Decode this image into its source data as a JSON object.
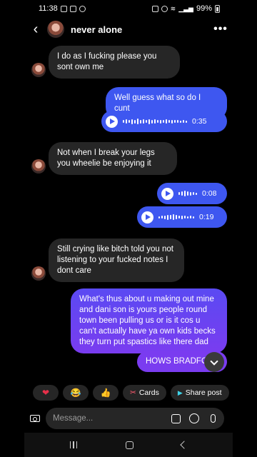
{
  "status_bar": {
    "time": "11:38",
    "battery": "99%"
  },
  "chat": {
    "name": "never alone"
  },
  "messages": [
    {
      "side": "in",
      "text": "I do as I fucking please you sont own me"
    },
    {
      "side": "out",
      "text": "Well guess what so do I cunt"
    },
    {
      "side": "out",
      "type": "voice",
      "duration": "0:35"
    },
    {
      "side": "in",
      "text": "Not when I break your legs you wheelie be enjoying it"
    },
    {
      "side": "out",
      "type": "voice",
      "duration": "0:08"
    },
    {
      "side": "out",
      "type": "voice",
      "duration": "0:19"
    },
    {
      "side": "in",
      "text": "Still crying like bitch told you not listening to your fucked notes I dont care"
    },
    {
      "side": "out",
      "text": "What's thus about u making out mine and dani son is yours people round town been pulling us or is it cos u can't actually have ya own kids becks they turn put spastics like there dad"
    },
    {
      "side": "out",
      "text": "HOWS BRADFORD"
    }
  ],
  "quick_replies": [
    {
      "icon": "heart-icon",
      "glyph": "❤"
    },
    {
      "icon": "laughing-emoji-icon",
      "glyph": "😂"
    },
    {
      "icon": "thumbs-up-icon",
      "glyph": "👍"
    },
    {
      "icon": "cards-icon",
      "label": "Cards"
    },
    {
      "icon": "share-post-icon",
      "label": "Share post"
    }
  ],
  "composer": {
    "placeholder": "Message..."
  },
  "colors": {
    "outgoing": "#3e57f0",
    "outgoing_gradient_end": "#7a3cf0",
    "incoming": "#262626",
    "background": "#000000"
  }
}
